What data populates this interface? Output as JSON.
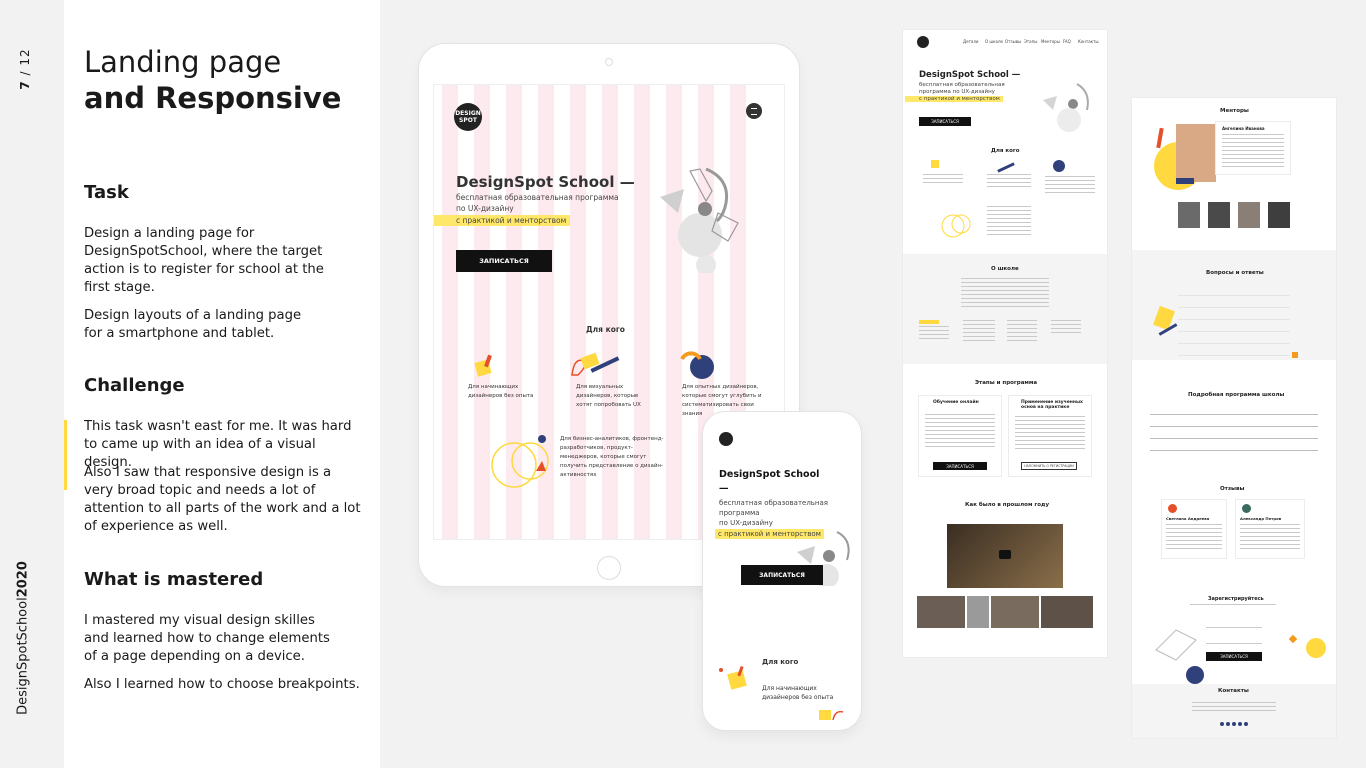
{
  "slide": {
    "current": "7",
    "sep": "/",
    "total": "12"
  },
  "project": {
    "name": "DesignSpotSchool",
    "year": "2020"
  },
  "heading": {
    "line1": "Landing page",
    "line2": "and Responsive"
  },
  "task": {
    "title": "Task",
    "p1": "Design a landing page for DesignSpotSchool, where the target action is to register for school at the first stage.",
    "p2": "Design layouts of a landing page for a smartphone and tablet."
  },
  "challenge": {
    "title": "Challenge",
    "p1": "This task wasn't east for me. It was hard to came up with an idea of a visual design.",
    "p2": "Also I saw that responsive design is a very broad topic and needs a lot of attention to all parts of the work and a lot of experience as well."
  },
  "mastered": {
    "title": "What is mastered",
    "p1": "I mastered my visual design skilles and learned how to change elements of a page depending on a device.",
    "p2": "Also I learned how to choose breakpoints."
  },
  "colors": {
    "accent_yellow": "#ffd93f",
    "highlight": "#ffe869",
    "navy": "#30407a",
    "red": "#e5502b",
    "stripe_pink": "#fde8ec"
  },
  "tablet": {
    "logo": "DESIGN SPOT",
    "hero_title": "DesignSpot School —",
    "hero_sub1": "бесплатная образовательная программа",
    "hero_sub2": "по UX-дизайну",
    "hero_hl": "с практикой и менторством",
    "cta": "ЗАПИСАТЬСЯ",
    "for_whom": "Для кого",
    "a1": "Для начинающих дизайнеров без опыта",
    "a2": "Для визуальных дизайнеров, которые хотят попробовать UX",
    "a3": "Для опытных дизайнеров, которые смогут углубить и систематизировать свои знания",
    "a4": "Для бизнес-аналитиков, фронтенд-разработчиков, продукт-менеджеров, которые смогут получить представление о дизайн-активностях"
  },
  "phone": {
    "hero_title": "DesignSpot School —",
    "hero_sub1": "бесплатная образовательная программа",
    "hero_sub2": "по UX-дизайну",
    "hero_hl": "с практикой и менторством",
    "cta": "ЗАПИСАТЬСЯ",
    "for_whom": "Для кого",
    "a1": "Для начинающих дизайнеров без опыта"
  },
  "desktop1": {
    "nav": [
      "Детали",
      "О школе",
      "Отзывы",
      "Этапы",
      "Менторы",
      "FAQ",
      "Контакты"
    ],
    "hero_title": "DesignSpot School —",
    "hero_sub": "бесплатная образовательная программа по UX-дизайну",
    "hero_hl": "с практикой и менторством",
    "cta": "ЗАПИСАТЬСЯ",
    "for_whom": "Для кого",
    "about": "О школе",
    "stages": "Этапы и программа",
    "stage1": "Обучение онлайн",
    "stage2": "Применение изученных основ на практике",
    "stage_btn1": "ЗАПИСАТЬСЯ",
    "stage_btn2": "НАПОМНИТЬ О РЕГИСТРАЦИИ",
    "past": "Как было в прошлом году"
  },
  "desktop2": {
    "mentors": "Менторы",
    "mentor_name": "Ангелина Иванова",
    "faq": "Вопросы и ответы",
    "program": "Подробная программа школы",
    "reviews": "Отзывы",
    "review1": "Светлана Андреева",
    "review2": "Александр Петров",
    "register": "Зарегистрируйтесь",
    "register_btn": "ЗАПИСАТЬСЯ",
    "contacts": "Контакты"
  }
}
